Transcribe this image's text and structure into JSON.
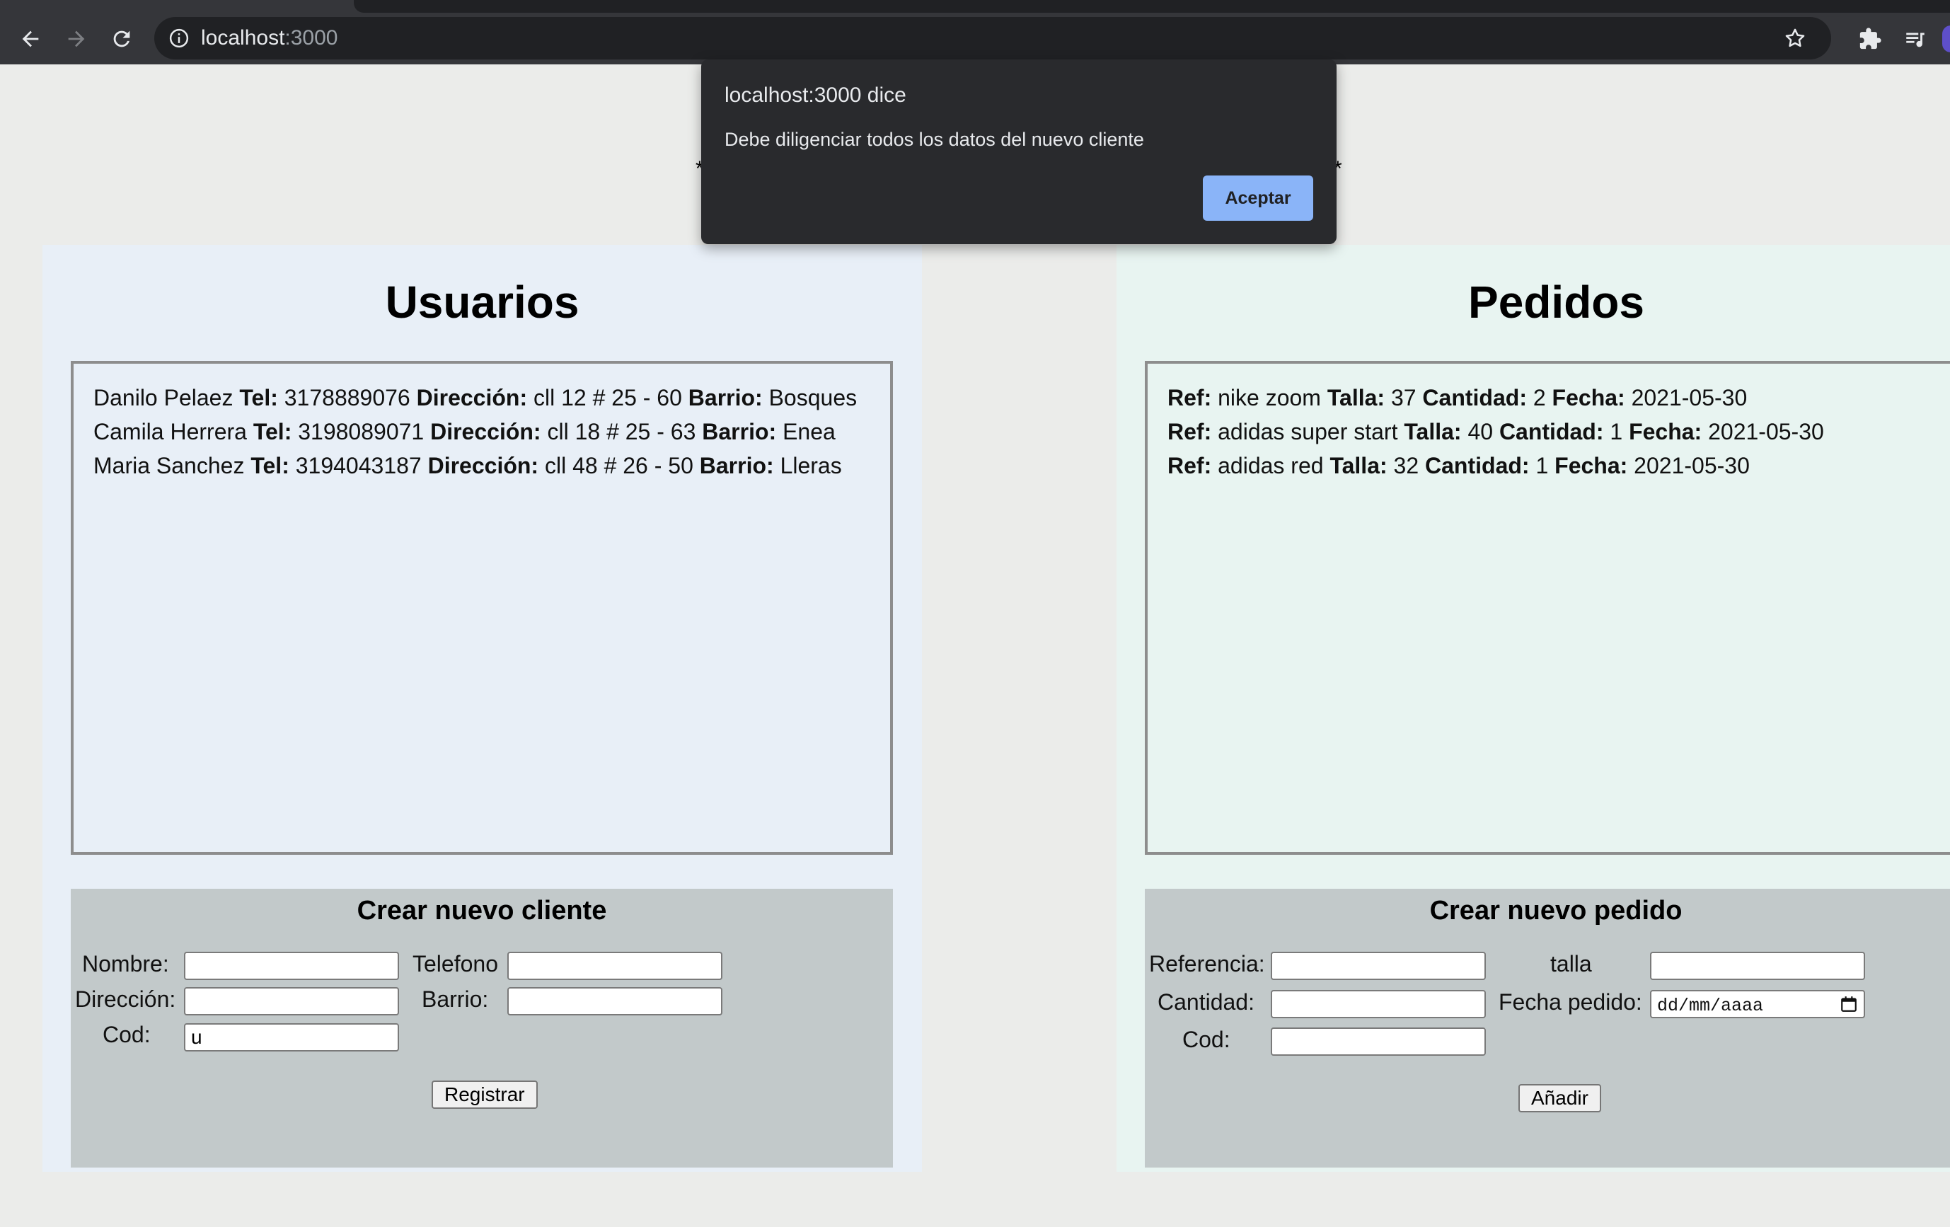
{
  "browser": {
    "url_host": "localhost",
    "url_port": ":3000"
  },
  "dialog": {
    "title": "localhost:3000 dice",
    "message": "Debe diligenciar todos los datos del nuevo cliente",
    "button": "Aceptar"
  },
  "usuarios": {
    "title": "Usuarios",
    "field_labels": {
      "tel": "Tel:",
      "direccion": "Dirección:",
      "barrio": "Barrio:"
    },
    "items": [
      {
        "name": "Danilo Pelaez",
        "tel": "3178889076",
        "direccion": "cll 12 # 25 - 60",
        "barrio": "Bosques"
      },
      {
        "name": "Camila Herrera",
        "tel": "3198089071",
        "direccion": "cll 18 # 25 - 63",
        "barrio": "Enea"
      },
      {
        "name": "Maria Sanchez",
        "tel": "3194043187",
        "direccion": "cll 48 # 26 - 50",
        "barrio": "Lleras"
      }
    ],
    "form": {
      "title": "Crear nuevo cliente",
      "nombre_label": "Nombre:",
      "telefono_label": "Telefono",
      "direccion_label": "Dirección:",
      "barrio_label": "Barrio:",
      "cod_label": "Cod:",
      "nombre_value": "",
      "telefono_value": "",
      "direccion_value": "",
      "barrio_value": "",
      "cod_value": "u",
      "submit": "Registrar"
    }
  },
  "pedidos": {
    "title": "Pedidos",
    "field_labels": {
      "ref": "Ref:",
      "talla": "Talla:",
      "cantidad": "Cantidad:",
      "fecha": "Fecha:"
    },
    "items": [
      {
        "ref": "nike zoom",
        "talla": "37",
        "cantidad": "2",
        "fecha": "2021-05-30"
      },
      {
        "ref": "adidas super start",
        "talla": "40",
        "cantidad": "1",
        "fecha": "2021-05-30"
      },
      {
        "ref": "adidas red",
        "talla": "32",
        "cantidad": "1",
        "fecha": "2021-05-30"
      }
    ],
    "form": {
      "title": "Crear nuevo pedido",
      "referencia_label": "Referencia:",
      "talla_label": "talla",
      "cantidad_label": "Cantidad:",
      "fecha_label": "Fecha pedido:",
      "cod_label": "Cod:",
      "referencia_value": "",
      "talla_value": "",
      "cantidad_value": "",
      "fecha_placeholder": "dd/mm/aaaa",
      "cod_value": "",
      "submit": "Añadir"
    }
  }
}
